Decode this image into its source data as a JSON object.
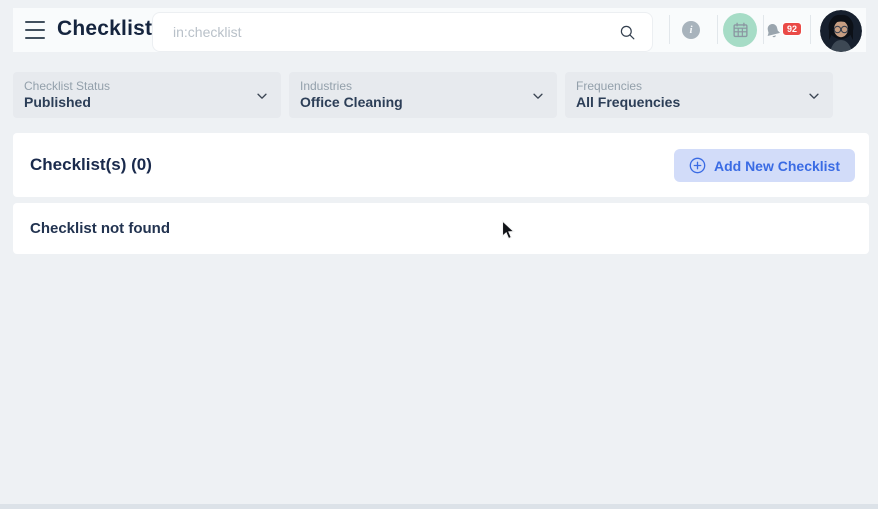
{
  "header": {
    "title": "Checklist",
    "search": {
      "placeholder": "in:checklist"
    },
    "notification_count": "92",
    "info_glyph": "i"
  },
  "filters": [
    {
      "label": "Checklist Status",
      "value": "Published"
    },
    {
      "label": "Industries",
      "value": "Office Cleaning"
    },
    {
      "label": "Frequencies",
      "value": "All Frequencies"
    }
  ],
  "content": {
    "list_header": "Checklist(s) (0)",
    "add_button_label": "Add New Checklist",
    "empty_message": "Checklist not found"
  },
  "colors": {
    "accent_blue": "#3a6be4",
    "accent_blue_bg": "#d2dcf9",
    "badge_red": "#ea4a47",
    "mint_green": "#a6dcc6",
    "dark_navy": "#1a2a4c",
    "page_bg": "#eef1f4"
  }
}
